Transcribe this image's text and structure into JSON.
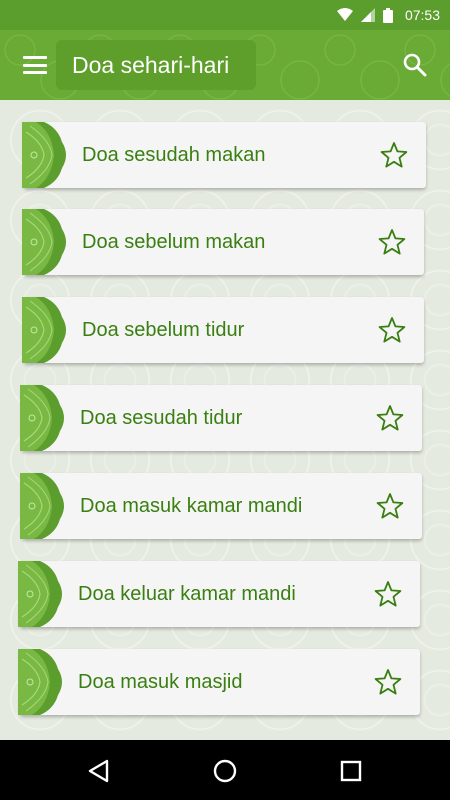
{
  "status_bar": {
    "time": "07:53",
    "icons": [
      "wifi-icon",
      "signal-icon",
      "battery-icon"
    ]
  },
  "app_bar": {
    "title": "Doa sehari-hari",
    "menu_icon": "menu-icon",
    "search_icon": "search-icon"
  },
  "colors": {
    "primary": "#6aab36",
    "primary_dark": "#5c9e2d",
    "accent_text": "#3a7f12",
    "card_bg": "#f5f5f5"
  },
  "list": {
    "items": [
      {
        "label": "Doa sesudah makan",
        "favorite": false
      },
      {
        "label": "Doa sebelum makan",
        "favorite": false
      },
      {
        "label": "Doa sebelum tidur",
        "favorite": false
      },
      {
        "label": "Doa sesudah tidur",
        "favorite": false
      },
      {
        "label": "Doa masuk kamar mandi",
        "favorite": false
      },
      {
        "label": "Doa keluar kamar mandi",
        "favorite": false
      },
      {
        "label": "Doa masuk masjid",
        "favorite": false
      }
    ]
  },
  "nav_bar": {
    "buttons": [
      "back-icon",
      "home-icon",
      "recents-icon"
    ]
  }
}
